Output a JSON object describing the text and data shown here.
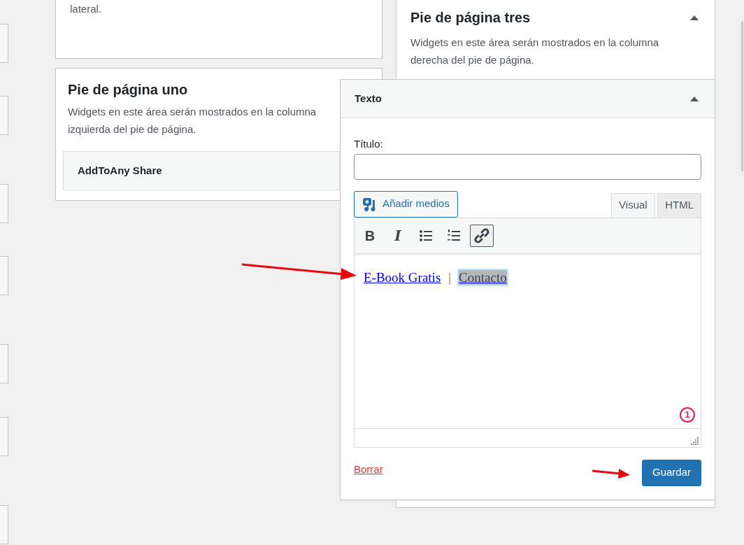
{
  "sidebar_area": {
    "description": "lateral."
  },
  "footer_one": {
    "title": "Pie de página uno",
    "description": "Widgets en este área serán mostrados en la columna izquierda del pie de página.",
    "widgets": [
      {
        "title": "AddToAny Share"
      }
    ]
  },
  "footer_three": {
    "title": "Pie de página tres",
    "description": "Widgets en este área serán mostrados en la columna derecha del pie de página.",
    "expanded": true
  },
  "text_widget": {
    "title": "Texto",
    "expanded": true,
    "title_label": "Título:",
    "add_media": "Añadir medios",
    "editor_tabs": [
      {
        "label": "Visual",
        "selected": true
      },
      {
        "label": "HTML",
        "selected": false
      }
    ],
    "toolbar": [
      {
        "kind": "bold",
        "label": "B",
        "active": false
      },
      {
        "kind": "italic",
        "label": "I",
        "active": false
      },
      {
        "kind": "bullet-list",
        "active": false
      },
      {
        "kind": "numbered-list",
        "active": false
      },
      {
        "kind": "link",
        "active": true
      }
    ],
    "content": [
      {
        "kind": "link",
        "text": "E-Book Gratis",
        "selected": false
      },
      {
        "kind": "separator",
        "text": "|"
      },
      {
        "kind": "link",
        "text": "Contacto",
        "selected": true
      }
    ],
    "badge": "1",
    "delete": "Borrar",
    "save": "Guardar"
  }
}
